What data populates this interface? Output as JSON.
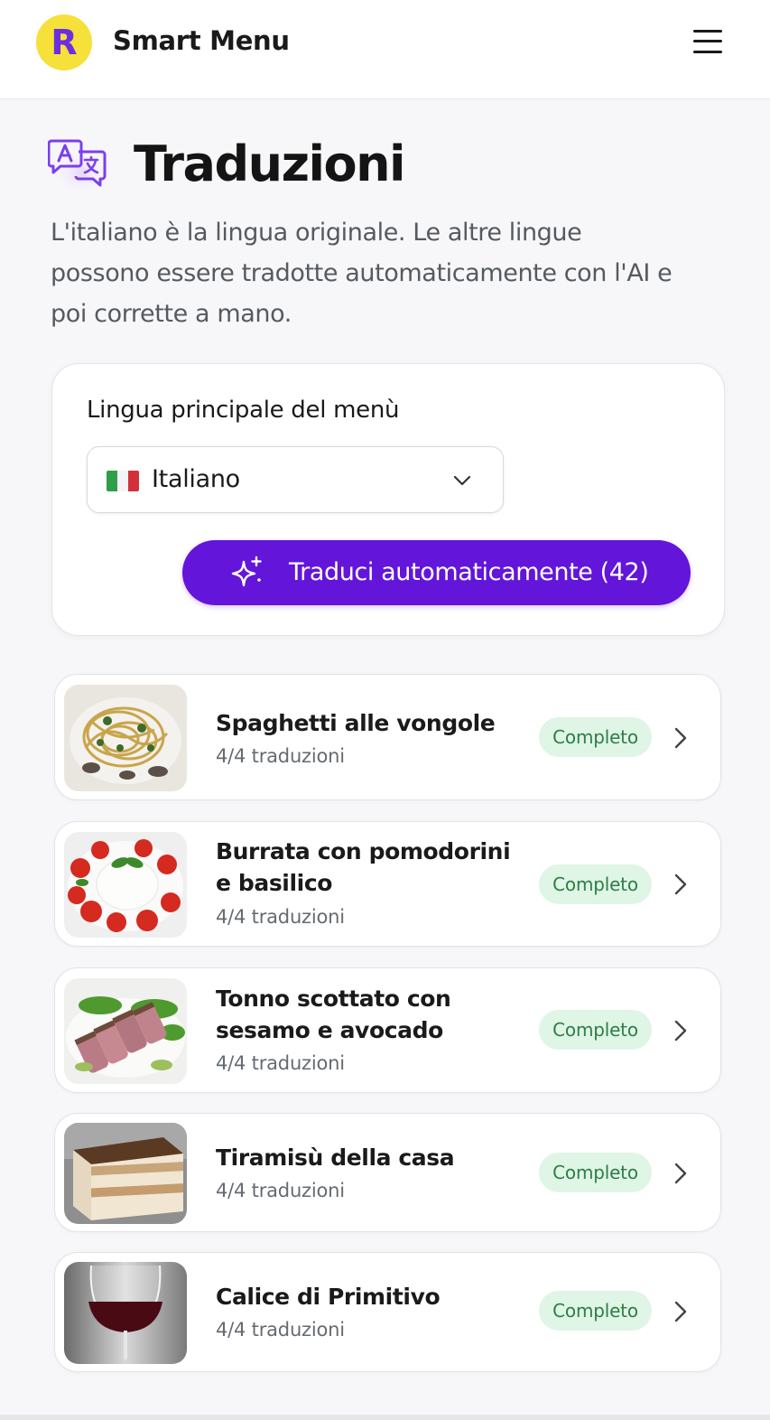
{
  "header": {
    "logo_letter": "R",
    "app_title": "Smart Menu",
    "menu_icon": "hamburger-menu-icon"
  },
  "page": {
    "icon": "translate-icon",
    "title": "Traduzioni",
    "description": "L'italiano è la lingua originale. Le altre lingue possono essere tradotte automaticamente con l'AI e poi corrette a mano."
  },
  "language_card": {
    "label": "Lingua principale del menù",
    "selected_language": "Italiano",
    "flag_icon": "italy-flag-icon",
    "translate_button_label": "Traduci automaticamente (42)"
  },
  "dishes": [
    {
      "name": "Spaghetti alle vongole",
      "subtitle": "4/4 traduzioni",
      "status": "Completo",
      "image": "spaghetti-image"
    },
    {
      "name": "Burrata con pomodorini e basilico",
      "subtitle": "4/4 traduzioni",
      "status": "Completo",
      "image": "burrata-image"
    },
    {
      "name": "Tonno scottato con sesamo e avocado",
      "subtitle": "4/4 traduzioni",
      "status": "Completo",
      "image": "tuna-image"
    },
    {
      "name": "Tiramisù della casa",
      "subtitle": "4/4 traduzioni",
      "status": "Completo",
      "image": "tiramisu-image"
    },
    {
      "name": "Calice di Primitivo",
      "subtitle": "4/4 traduzioni",
      "status": "Completo",
      "image": "red-wine-image"
    }
  ],
  "colors": {
    "accent": "#6315d9",
    "logo_bg": "#f6e03a",
    "badge_bg": "#dff5e6",
    "badge_text": "#2e7d46"
  }
}
